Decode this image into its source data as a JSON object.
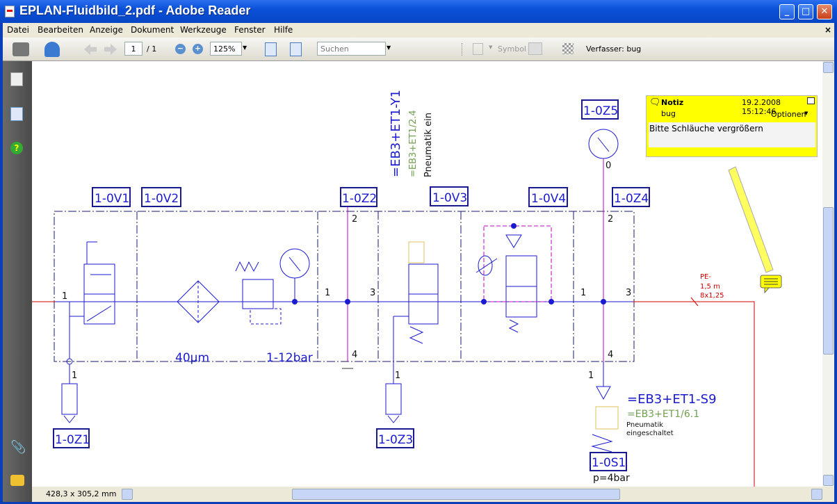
{
  "window": {
    "title": "EPLAN-Fluidbild_2.pdf - Adobe Reader",
    "minimize": "_",
    "maximize": "□",
    "close": "✕"
  },
  "menu": [
    "Datei",
    "Bearbeiten",
    "Anzeige",
    "Dokument",
    "Werkzeuge",
    "Fenster",
    "Hilfe"
  ],
  "menu_close": "×",
  "toolbar": {
    "page_current": "1",
    "page_total": "/ 1",
    "zoom": "125%",
    "search_placeholder": "Suchen",
    "symbol_label": "Symbol",
    "author": "Verfasser: bug"
  },
  "status": {
    "page_size": "428,3 x 305,2 mm"
  },
  "note": {
    "title": "Notiz",
    "timestamp": "19.2.2008 15:12:46",
    "author": "bug",
    "options": "Optionen",
    "text": "Bitte Schläuche vergrößern"
  },
  "diagram": {
    "labels": {
      "v1": "1-0V1",
      "v2": "1-0V2",
      "z2": "1-0Z2",
      "v3": "1-0V3",
      "v4": "1-0V4",
      "z4": "1-0Z4",
      "z5": "1-0Z5",
      "z1": "1-0Z1",
      "z3": "1-0Z3",
      "s1": "1-0S1"
    },
    "filter": "40µm",
    "regulator": "1-12bar",
    "gauge_zero": "0",
    "y1_ref": "=EB3+ET1-Y1",
    "y1_page": "=EB3+ET1/2.4",
    "y1_desc": "Pneumatik ein",
    "s9_ref": "=EB3+ET1-S9",
    "s9_page": "=EB3+ET1/6.1",
    "s9_desc1": "Pneumatik",
    "s9_desc2": "eingeschaltet",
    "pressure": "p=4bar",
    "hose": [
      "PE-",
      "1,5 m",
      "8x1,25"
    ],
    "ports": {
      "p1": "1",
      "p2": "2",
      "p3": "3",
      "p4": "4"
    }
  },
  "colors": {
    "line": "#1a1ad0",
    "hose": "#d00000",
    "pilot": "#c000c0",
    "note": "#ffff00"
  }
}
